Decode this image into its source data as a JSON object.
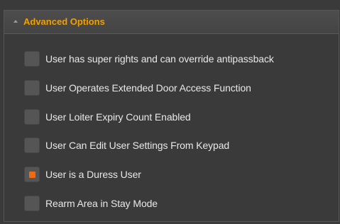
{
  "panel": {
    "title": "Advanced Options",
    "collapse_icon": "triangle-up-icon",
    "accent_color": "#f0a000"
  },
  "options": [
    {
      "label": "User has super rights and can override antipassback",
      "checked": false
    },
    {
      "label": "User Operates Extended Door Access Function",
      "checked": false
    },
    {
      "label": "User Loiter Expiry Count Enabled",
      "checked": false
    },
    {
      "label": "User Can Edit User Settings From Keypad",
      "checked": false
    },
    {
      "label": "User is a Duress User",
      "checked": true
    },
    {
      "label": "Rearm Area in Stay Mode",
      "checked": false
    }
  ],
  "checked_color": "#f06a10"
}
